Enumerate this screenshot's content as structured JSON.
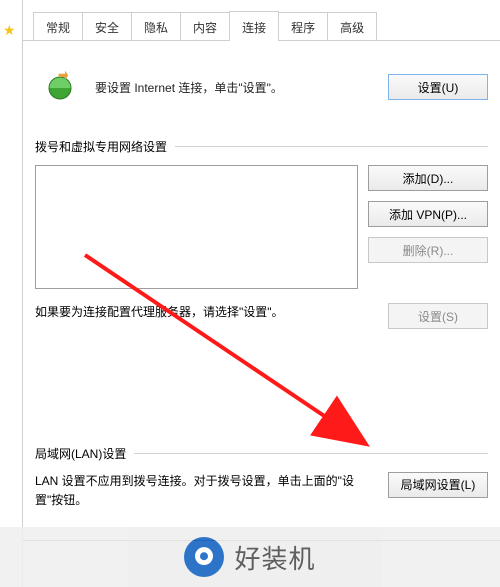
{
  "tabs": {
    "general": "常规",
    "security": "安全",
    "privacy": "隐私",
    "content": "内容",
    "connections": "连接",
    "programs": "程序",
    "advanced": "高级",
    "active": "connections"
  },
  "intro": {
    "text": "要设置 Internet 连接，单击\"设置\"。",
    "setup_button": "设置(U)"
  },
  "dial": {
    "section_title": "拨号和虚拟专用网络设置",
    "add_button": "添加(D)...",
    "add_vpn_button": "添加 VPN(P)...",
    "remove_button": "删除(R)...",
    "note": "如果要为连接配置代理服务器，请选择\"设置\"。",
    "settings_button": "设置(S)"
  },
  "lan": {
    "section_title": "局域网(LAN)设置",
    "text": "LAN 设置不应用到拨号连接。对于拨号设置，单击上面的\"设置\"按钮。",
    "button": "局域网设置(L)"
  },
  "watermark": {
    "text": "好装机"
  }
}
